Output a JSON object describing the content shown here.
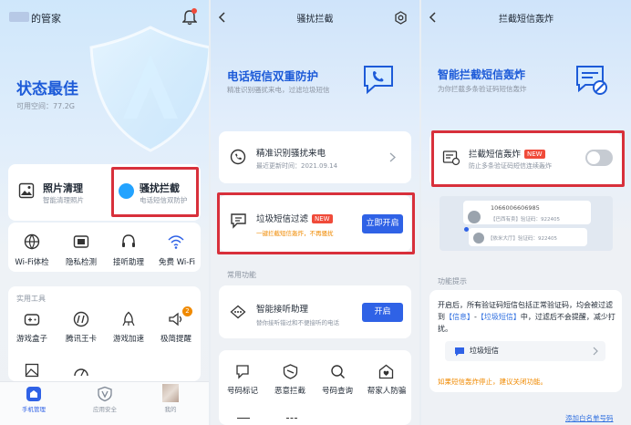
{
  "p1": {
    "title": "的管家",
    "status": "状态最佳",
    "space": "可用空间：77.2G",
    "photo_title": "照片清理",
    "photo_sub": "智能清理照片",
    "block_title": "骚扰拦截",
    "block_sub": "电话短信双防护",
    "quick": [
      "Wi-Fi体检",
      "隐私检测",
      "接听助理",
      "免费 Wi-Fi"
    ],
    "tools_label": "实用工具",
    "tools": [
      "游戏盒子",
      "腾讯王卡",
      "游戏加速",
      "极简提醒"
    ],
    "tabs": [
      "手机管理",
      "应用安全",
      "我的"
    ],
    "badge_count": "2"
  },
  "p2": {
    "header": "骚扰拦截",
    "hero_title": "电话短信双重防护",
    "hero_sub": "精准识别骚扰来电，过滤垃圾短信",
    "call_title": "精准识别骚扰来电",
    "call_sub": "最近更新时间：2021.09.14",
    "sms_title": "垃圾短信过滤",
    "sms_new": "NEW",
    "sms_sub": "一键拦截短信轰炸，不再骚扰",
    "sms_button": "立即开启",
    "common_label": "常用功能",
    "assist_title": "智能接听助理",
    "assist_sub": "替你接听错过和不便接听的电话",
    "assist_button": "开启",
    "grid": [
      "号码标记",
      "恶意拦截",
      "号码查询",
      "帮家人防骗"
    ]
  },
  "p3": {
    "header": "拦截短信轰炸",
    "hero_title": "智能拦截短信轰炸",
    "hero_sub": "为你拦截多条验证码短信轰炸",
    "toggle_title": "拦截短信轰炸",
    "toggle_new": "NEW",
    "toggle_sub": "防止多条验证码短信连续轰炸",
    "sample_number": "1066006606985",
    "sample_line1": "【巴西有卖】验证码：922405",
    "sample_line2": "【依米大厅】验证码：922405",
    "tips_label": "功能提示",
    "tips_text_a": "开启后，所有验证码短信包括正常验证码，均会被过滤到",
    "tips_link1": "【信息】",
    "tips_dash": "-",
    "tips_link2": "【垃圾短信】",
    "tips_text_b": "中，过滤后不会提醒，减少打扰。",
    "spam_link": "垃圾短信",
    "warning": "如果短信轰炸停止，建议关闭功能。",
    "footer_link": "添加白名单号码"
  },
  "colors": {
    "accent": "#2f62e6",
    "highlight": "#d8303b",
    "new": "#f04b3a",
    "orange": "#f08a00"
  }
}
